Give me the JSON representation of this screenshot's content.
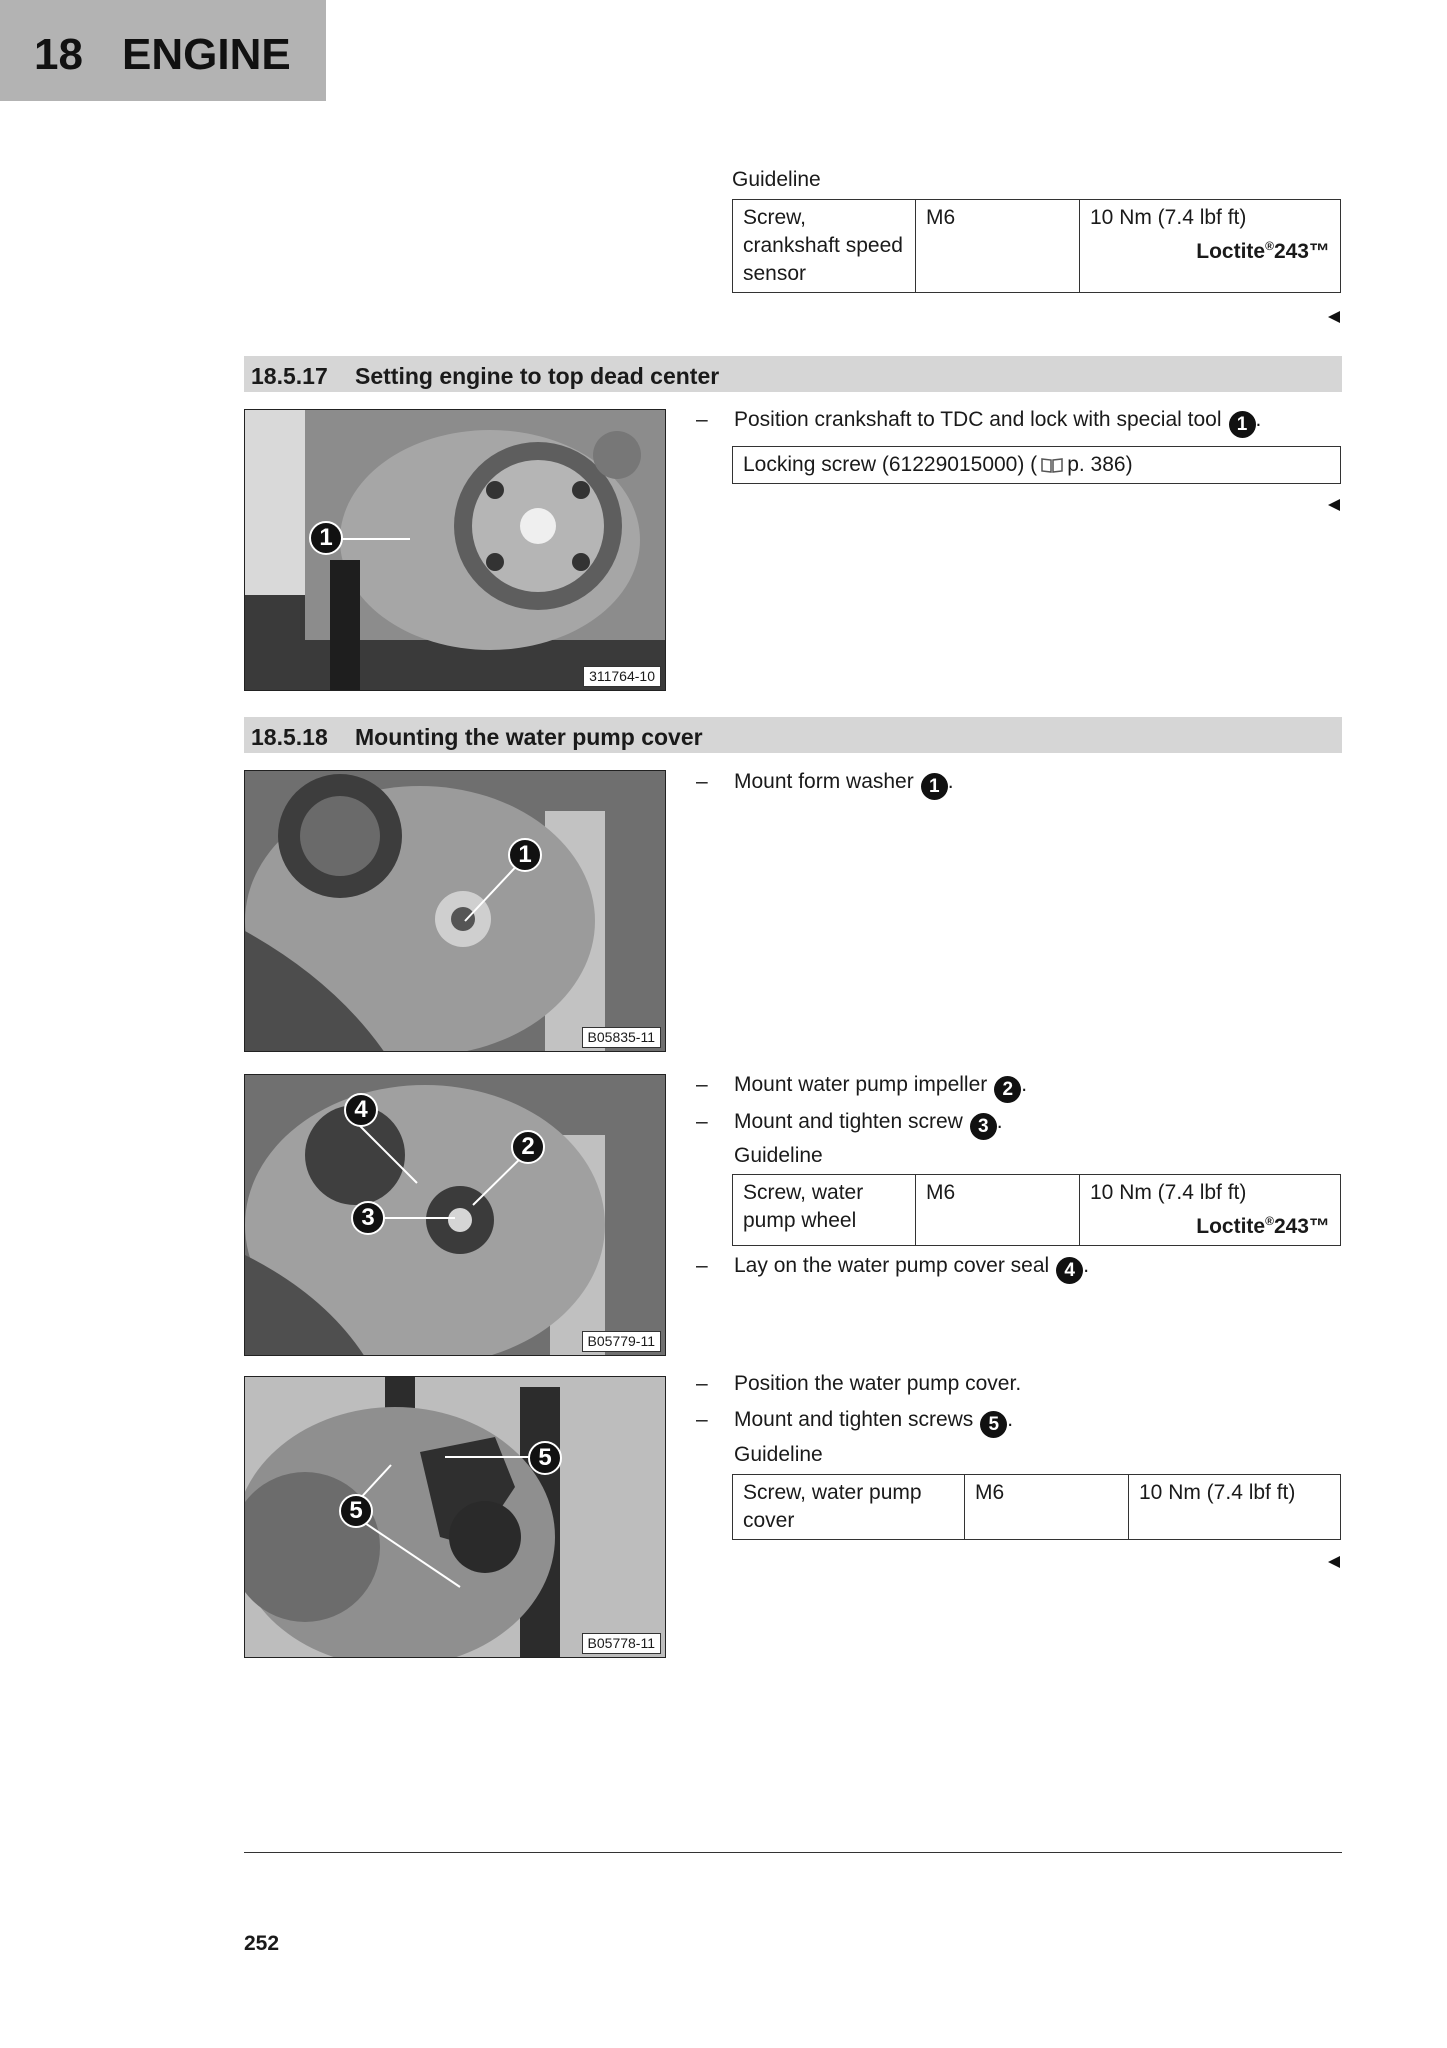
{
  "chapter": {
    "number": "18",
    "title": "ENGINE"
  },
  "top_guideline": {
    "label": "Guideline",
    "row": {
      "item": "Screw, crankshaft speed sensor",
      "thread": "M6",
      "torque": "10 Nm (7.4 lbf ft)",
      "loctite": "Loctite®243™"
    }
  },
  "section_1": {
    "number": "18.5.17",
    "title": "Setting engine to top dead center",
    "step1_text": "Position crankshaft to TDC and lock with special tool",
    "step1_badge": "1",
    "special_tool": "Locking screw (61229015000) (",
    "special_tool_ref": "p. 386)",
    "photo": {
      "code": "311764-10",
      "callouts": [
        "1"
      ]
    }
  },
  "section_2": {
    "number": "18.5.18",
    "title": "Mounting the water pump cover",
    "photo_1": {
      "code": "B05835-11",
      "callouts": [
        "1"
      ]
    },
    "photo_2": {
      "code": "B05779-11",
      "callouts": [
        "4",
        "2",
        "3"
      ]
    },
    "photo_3": {
      "code": "B05778-11",
      "callouts": [
        "5",
        "5"
      ]
    },
    "steps": [
      {
        "text": "Mount form washer",
        "badge": "1"
      },
      {
        "text": "Mount water pump impeller",
        "badge": "2"
      },
      {
        "text": "Mount and tighten screw",
        "badge": "3"
      },
      {
        "text": "Lay on the water pump cover seal",
        "badge": "4"
      },
      {
        "text": "Position the water pump cover."
      },
      {
        "text": "Mount and tighten screws",
        "badge": "5"
      }
    ],
    "guideline_label": "Guideline",
    "table_impeller": {
      "item": "Screw, water pump wheel",
      "thread": "M6",
      "torque": "10 Nm (7.4 lbf ft)",
      "loctite": "Loctite®243™"
    },
    "table_cover": {
      "item": "Screw, water pump cover",
      "thread": "M6",
      "torque": "10 Nm (7.4 lbf ft)"
    }
  },
  "footer": {
    "page_number": "252"
  }
}
